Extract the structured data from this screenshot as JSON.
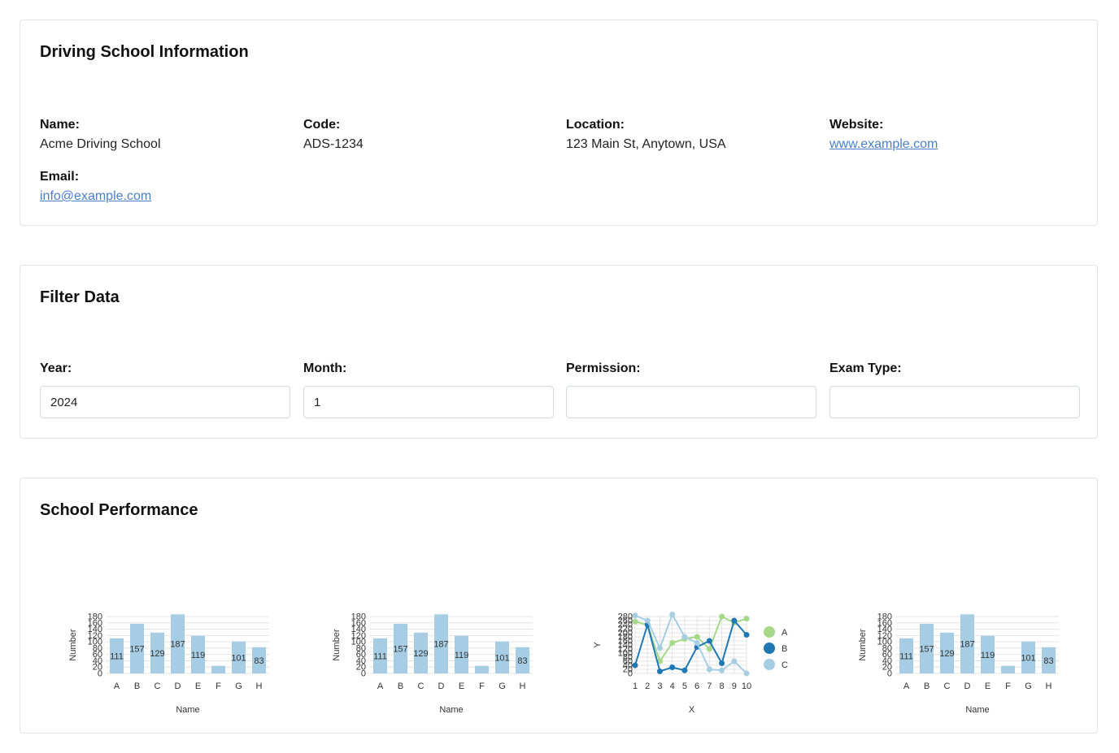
{
  "info": {
    "title": "Driving School Information",
    "name_label": "Name:",
    "name": "Acme Driving School",
    "code_label": "Code:",
    "code": "ADS-1234",
    "location_label": "Location:",
    "location": "123 Main St, Anytown, USA",
    "website_label": "Website:",
    "website": "www.example.com",
    "email_label": "Email:",
    "email": "info@example.com"
  },
  "filter": {
    "title": "Filter Data",
    "year_label": "Year:",
    "year_value": "2024",
    "month_label": "Month:",
    "month_value": "1",
    "permission_label": "Permission:",
    "permission_value": "",
    "exam_label": "Exam Type:",
    "exam_value": ""
  },
  "performance": {
    "title": "School Performance"
  },
  "colors": {
    "bar": "#a6cde3",
    "A": "#a6d88a",
    "B": "#1f78b4",
    "C": "#a6cee3",
    "grid": "#e3e3e3"
  },
  "chart_data": [
    {
      "type": "bar",
      "categories": [
        "A",
        "B",
        "C",
        "D",
        "E",
        "F",
        "G",
        "H"
      ],
      "values": [
        111,
        157,
        129,
        187,
        119,
        24,
        101,
        83
      ],
      "data_labels": [
        "111",
        "157",
        "129",
        "187",
        "119",
        "",
        "101",
        "83"
      ],
      "xlabel": "Name",
      "ylabel": "Number",
      "ylim": [
        0,
        180
      ],
      "yticks": [
        0,
        20,
        40,
        60,
        80,
        100,
        120,
        140,
        160,
        180
      ]
    },
    {
      "type": "bar",
      "categories": [
        "A",
        "B",
        "C",
        "D",
        "E",
        "F",
        "G",
        "H"
      ],
      "values": [
        111,
        157,
        129,
        187,
        119,
        24,
        101,
        83
      ],
      "data_labels": [
        "111",
        "157",
        "129",
        "187",
        "119",
        "",
        "101",
        "83"
      ],
      "xlabel": "Name",
      "ylabel": "Number",
      "ylim": [
        0,
        180
      ],
      "yticks": [
        0,
        20,
        40,
        60,
        80,
        100,
        120,
        140,
        160,
        180
      ]
    },
    {
      "type": "line",
      "x": [
        1,
        2,
        3,
        4,
        5,
        6,
        7,
        8,
        9,
        10
      ],
      "series": [
        {
          "name": "A",
          "values": [
            255,
            240,
            60,
            150,
            170,
            180,
            120,
            280,
            250,
            270
          ]
        },
        {
          "name": "B",
          "values": [
            40,
            240,
            10,
            30,
            15,
            130,
            160,
            50,
            260,
            190
          ]
        },
        {
          "name": "C",
          "values": [
            285,
            260,
            125,
            290,
            180,
            150,
            20,
            15,
            60,
            0
          ]
        }
      ],
      "xlabel": "X",
      "ylabel": "Y",
      "ylim": [
        0,
        280
      ],
      "yticks": [
        0,
        20,
        40,
        60,
        80,
        100,
        120,
        140,
        160,
        180,
        200,
        220,
        240,
        260,
        280
      ],
      "legend": "right"
    },
    {
      "type": "bar",
      "categories": [
        "A",
        "B",
        "C",
        "D",
        "E",
        "F",
        "G",
        "H"
      ],
      "values": [
        111,
        157,
        129,
        187,
        119,
        24,
        101,
        83
      ],
      "data_labels": [
        "111",
        "157",
        "129",
        "187",
        "119",
        "",
        "101",
        "83"
      ],
      "xlabel": "Name",
      "ylabel": "Number",
      "ylim": [
        0,
        180
      ],
      "yticks": [
        0,
        20,
        40,
        60,
        80,
        100,
        120,
        140,
        160,
        180
      ]
    }
  ]
}
